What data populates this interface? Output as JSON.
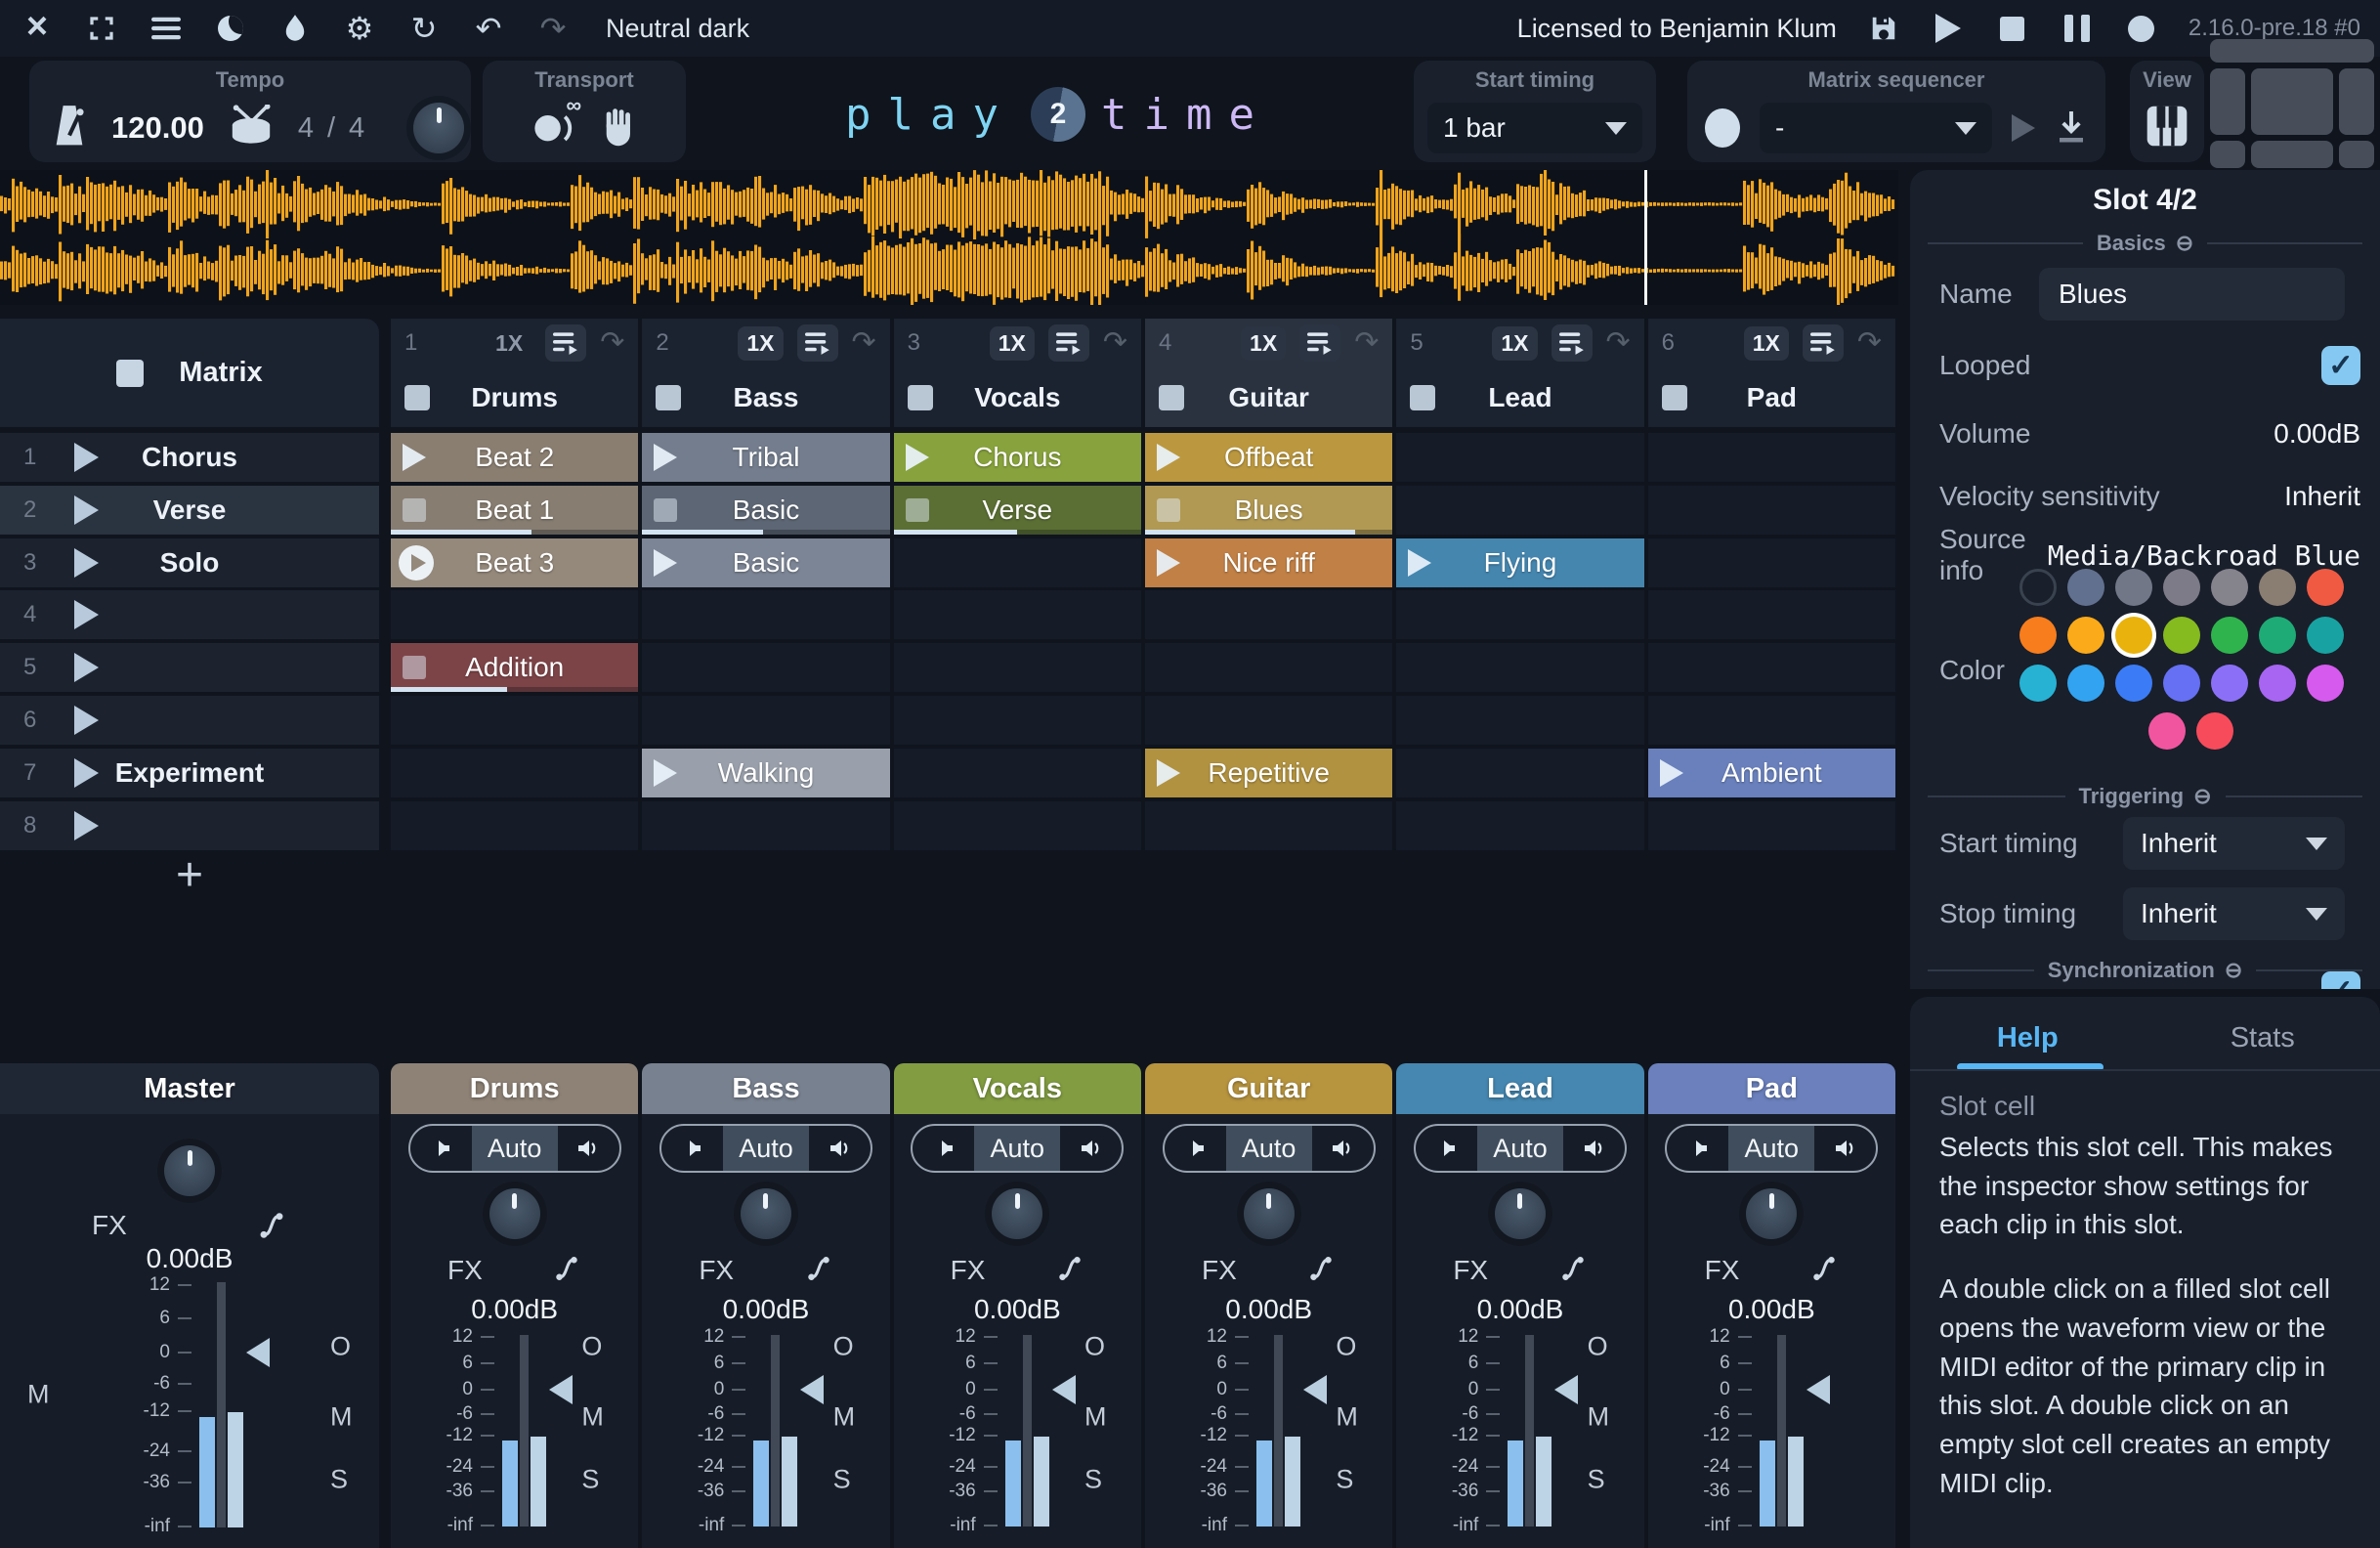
{
  "titlebar": {
    "theme_name": "Neutral dark",
    "license": "Licensed to Benjamin Klum",
    "version": "2.16.0-pre.18 #0"
  },
  "toolbar": {
    "tempo": {
      "label": "Tempo",
      "bpm": "120.00",
      "sig_num": "4",
      "sig_sep": "/",
      "sig_den": "4"
    },
    "transport": {
      "label": "Transport",
      "infinity": "∞"
    },
    "start_timing": {
      "label": "Start timing",
      "value": "1 bar"
    },
    "matrix_sequencer": {
      "label": "Matrix sequencer",
      "value": "-"
    },
    "view": {
      "label": "View"
    }
  },
  "logo": {
    "word1": "play",
    "number": "2",
    "word2": "time"
  },
  "matrix": {
    "header_label": "Matrix",
    "add_button": "+",
    "rows": [
      {
        "num": "1",
        "name": "Chorus",
        "highlight": false
      },
      {
        "num": "2",
        "name": "Verse",
        "highlight": true
      },
      {
        "num": "3",
        "name": "Solo",
        "highlight": false
      },
      {
        "num": "4",
        "name": "",
        "highlight": false
      },
      {
        "num": "5",
        "name": "",
        "highlight": false
      },
      {
        "num": "6",
        "name": "",
        "highlight": false
      },
      {
        "num": "7",
        "name": "Experiment",
        "highlight": false
      },
      {
        "num": "8",
        "name": "",
        "highlight": false
      }
    ],
    "columns": [
      {
        "num": "1",
        "name": "Drums",
        "repeat": "1X",
        "repeat_boxed": false,
        "selected": false
      },
      {
        "num": "2",
        "name": "Bass",
        "repeat": "1X",
        "repeat_boxed": true,
        "selected": false
      },
      {
        "num": "3",
        "name": "Vocals",
        "repeat": "1X",
        "repeat_boxed": true,
        "selected": false
      },
      {
        "num": "4",
        "name": "Guitar",
        "repeat": "1X",
        "repeat_boxed": true,
        "selected": true
      },
      {
        "num": "5",
        "name": "Lead",
        "repeat": "1X",
        "repeat_boxed": true,
        "selected": false
      },
      {
        "num": "6",
        "name": "Pad",
        "repeat": "1X",
        "repeat_boxed": true,
        "selected": false
      }
    ],
    "cells": [
      {
        "col": 0,
        "row": 0,
        "label": "Beat 2",
        "color": "#8a7e71",
        "icon": "play"
      },
      {
        "col": 0,
        "row": 1,
        "label": "Beat 1",
        "color": "#877d71",
        "icon": "stop",
        "progress": 0.57
      },
      {
        "col": 0,
        "row": 2,
        "label": "Beat 3",
        "color": "#95897b",
        "icon": "playing"
      },
      {
        "col": 0,
        "row": 4,
        "label": "Addition",
        "color": "#7d4448",
        "icon": "stop",
        "progress": 0.47
      },
      {
        "col": 1,
        "row": 0,
        "label": "Tribal",
        "color": "#737d8d",
        "icon": "play"
      },
      {
        "col": 1,
        "row": 1,
        "label": "Basic",
        "color": "#5d6674",
        "icon": "stop",
        "progress": 0.49
      },
      {
        "col": 1,
        "row": 2,
        "label": "Basic",
        "color": "#7c8595",
        "icon": "play"
      },
      {
        "col": 1,
        "row": 6,
        "label": "Walking",
        "color": "#99a0ab",
        "icon": "play"
      },
      {
        "col": 2,
        "row": 0,
        "label": "Chorus",
        "color": "#88a23d",
        "icon": "play"
      },
      {
        "col": 2,
        "row": 1,
        "label": "Verse",
        "color": "#5b6f34",
        "icon": "stop",
        "progress": 0.5
      },
      {
        "col": 3,
        "row": 0,
        "label": "Offbeat",
        "color": "#bb983f",
        "icon": "play"
      },
      {
        "col": 3,
        "row": 1,
        "label": "Blues",
        "color": "#b19953",
        "icon": "stop",
        "progress": 0.85
      },
      {
        "col": 3,
        "row": 2,
        "label": "Nice riff",
        "color": "#c08046",
        "icon": "play"
      },
      {
        "col": 3,
        "row": 6,
        "label": "Repetitive",
        "color": "#b19240",
        "icon": "play"
      },
      {
        "col": 4,
        "row": 2,
        "label": "Flying",
        "color": "#4586af",
        "icon": "play"
      },
      {
        "col": 5,
        "row": 6,
        "label": "Ambient",
        "color": "#6980bc",
        "icon": "play"
      }
    ]
  },
  "inspector": {
    "title": "Slot 4/2",
    "collapse_glyph": "⊖",
    "sections": {
      "basics": "Basics",
      "triggering": "Triggering",
      "synchronization": "Synchronization"
    },
    "name_label": "Name",
    "name_value": "Blues",
    "looped_label": "Looped",
    "looped_checked": true,
    "check_glyph": "✓",
    "volume_label": "Volume",
    "volume_value": "0.00dB",
    "velocity_label": "Velocity sensitivity",
    "velocity_value": "Inherit",
    "source_label": "Source info",
    "source_value": "Media/Backroad Blue",
    "color_label": "Color",
    "selected_color": "#e9b20c",
    "palette": [
      [
        "none",
        "#62708f",
        "#717787",
        "#7e7b88",
        "#85838c",
        "#8a7d72",
        "#f05a43"
      ],
      [
        "#f87d1c",
        "#fbaa1a",
        "#e9b20c",
        "#85bb1e",
        "#2fb44d",
        "#1fab76",
        "#18a3a2"
      ],
      [
        "#27b2d4",
        "#31a3f0",
        "#3b7cf6",
        "#6570f4",
        "#8b70f7",
        "#a765f2",
        "#d65aee"
      ],
      [
        "#f2559f",
        "#f74b5c"
      ]
    ],
    "start_timing_label": "Start timing",
    "start_timing_value": "Inherit",
    "stop_timing_label": "Stop timing",
    "stop_timing_value": "Inherit"
  },
  "help": {
    "tab_help": "Help",
    "tab_stats": "Stats",
    "heading": "Slot cell",
    "p1": "Selects this slot cell. This makes the inspector show settings for each clip in this slot.",
    "p2": "A double click on a filled slot cell opens the waveform view or the MIDI editor of the primary clip in this slot. A double click on an empty slot cell creates an empty MIDI clip."
  },
  "mixer": {
    "auto_label": "Auto",
    "fx_label": "FX",
    "db_value": "0.00dB",
    "scale": [
      "12",
      "6",
      "0",
      "-6",
      "-12",
      "-24",
      "-36",
      "-inf"
    ],
    "master": {
      "name": "Master",
      "db": "0.00dB"
    },
    "channels": [
      {
        "name": "Drums",
        "color": "#8e8276"
      },
      {
        "name": "Bass",
        "color": "#78818f"
      },
      {
        "name": "Vocals",
        "color": "#829c41"
      },
      {
        "name": "Guitar",
        "color": "#b7943e"
      },
      {
        "name": "Lead",
        "color": "#4587b0"
      },
      {
        "name": "Pad",
        "color": "#6b80bd"
      }
    ]
  },
  "colors": {
    "accent": "#58b7f5",
    "waveform": "#f0a41c"
  }
}
